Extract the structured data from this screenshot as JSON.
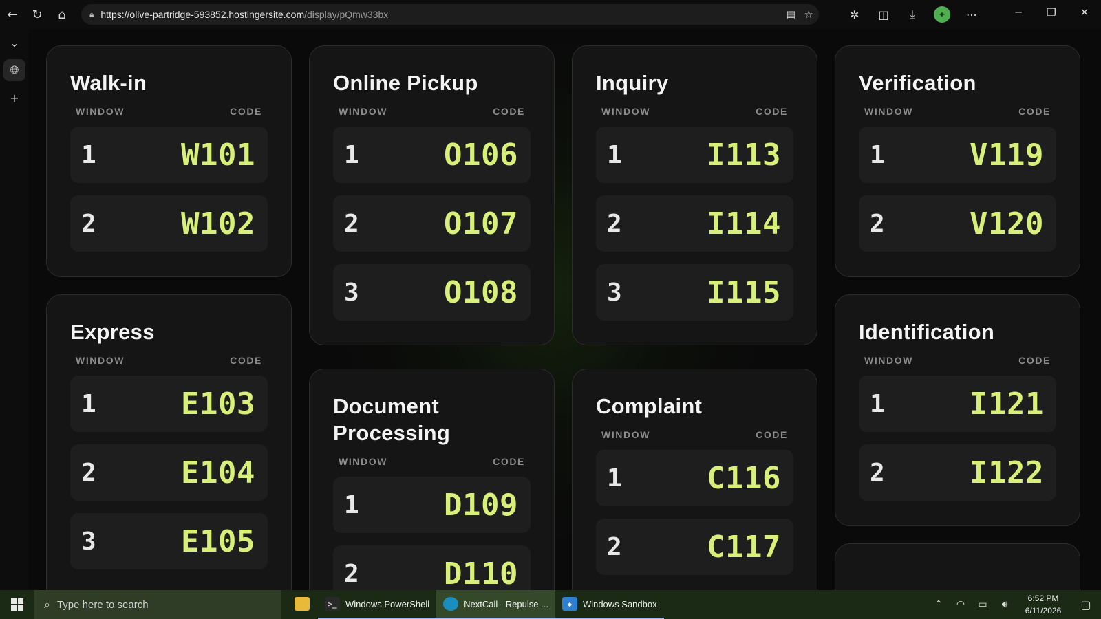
{
  "browser": {
    "url_host": "https://olive-partridge-593852.hostingersite.com",
    "url_path": "/display/pQmw33bx"
  },
  "headers": {
    "window": "WINDOW",
    "code": "CODE"
  },
  "services": [
    {
      "title": "Walk-in",
      "rows": [
        {
          "window": "1",
          "code": "W101"
        },
        {
          "window": "2",
          "code": "W102"
        }
      ]
    },
    {
      "title": "Express",
      "rows": [
        {
          "window": "1",
          "code": "E103"
        },
        {
          "window": "2",
          "code": "E104"
        },
        {
          "window": "3",
          "code": "E105"
        }
      ]
    },
    {
      "title": "Online Pickup",
      "rows": [
        {
          "window": "1",
          "code": "O106"
        },
        {
          "window": "2",
          "code": "O107"
        },
        {
          "window": "3",
          "code": "O108"
        }
      ]
    },
    {
      "title": "Document Processing",
      "rows": [
        {
          "window": "1",
          "code": "D109"
        },
        {
          "window": "2",
          "code": "D110"
        }
      ]
    },
    {
      "title": "Inquiry",
      "rows": [
        {
          "window": "1",
          "code": "I113"
        },
        {
          "window": "2",
          "code": "I114"
        },
        {
          "window": "3",
          "code": "I115"
        }
      ]
    },
    {
      "title": "Complaint",
      "rows": [
        {
          "window": "1",
          "code": "C116"
        },
        {
          "window": "2",
          "code": "C117"
        }
      ]
    },
    {
      "title": "Verification",
      "rows": [
        {
          "window": "1",
          "code": "V119"
        },
        {
          "window": "2",
          "code": "V120"
        }
      ]
    },
    {
      "title": "Identification",
      "rows": [
        {
          "window": "1",
          "code": "I121"
        },
        {
          "window": "2",
          "code": "I122"
        }
      ]
    }
  ],
  "taskbar": {
    "search_placeholder": "Type here to search",
    "apps": [
      "Windows PowerShell",
      "NextCall - Repulse ...",
      "Windows Sandbox"
    ],
    "time": "6:52 PM",
    "date": "6/11/2026"
  },
  "colors": {
    "code": "#d8f07a",
    "card": "#151515",
    "row": "#1e1e1e"
  }
}
